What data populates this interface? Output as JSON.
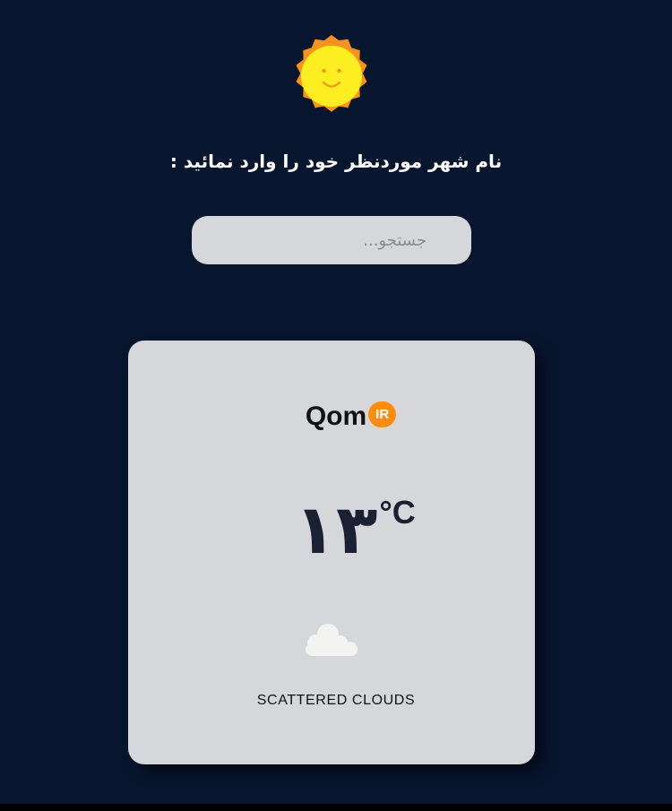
{
  "header": {
    "logo_icon": "sun-smiley-icon",
    "prompt": "نام شهر موردنظر خود را وارد نمائید :"
  },
  "search": {
    "placeholder": "جستجو...",
    "value": ""
  },
  "weather": {
    "city": "Qom",
    "country": "IR",
    "temperature": "۱۳",
    "unit": "°C",
    "icon": "cloud-icon",
    "description": "SCATTERED CLOUDS"
  },
  "colors": {
    "background": "#07152e",
    "card": "#d6d7db",
    "country_badge": "#ff8c0c",
    "sun_outer": "#f7921e",
    "sun_inner": "#fcee21"
  }
}
